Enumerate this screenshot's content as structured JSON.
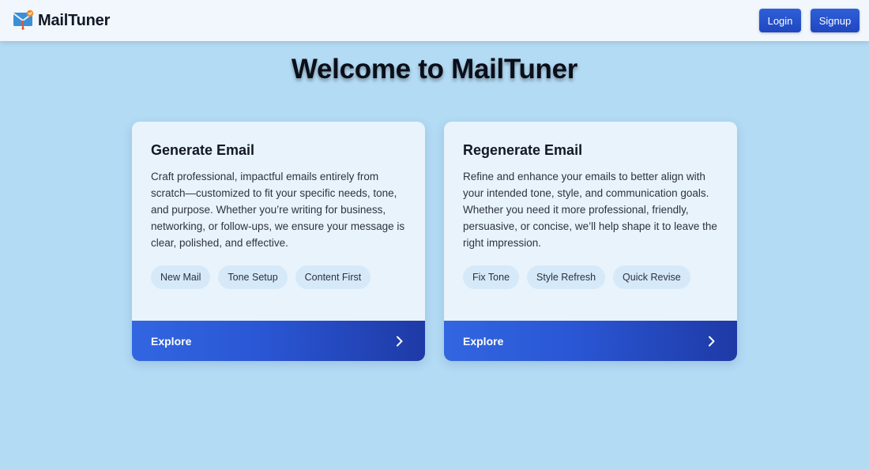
{
  "header": {
    "brand": "MailTuner",
    "login_label": "Login",
    "signup_label": "Signup"
  },
  "main": {
    "title": "Welcome to MailTuner",
    "cards": [
      {
        "title": "Generate Email",
        "description": "Craft professional, impactful emails entirely from scratch—customized to fit your specific needs, tone, and purpose. Whether you’re writing for business, networking, or follow-ups, we ensure your message is clear, polished, and effective.",
        "tags": [
          "New Mail",
          "Tone Setup",
          "Content First"
        ],
        "action_label": "Explore",
        "action_icon": "chevron-right-icon"
      },
      {
        "title": "Regenerate Email",
        "description": "Refine and enhance your emails to better align with your intended tone, style, and communication goals. Whether you need it more professional, friendly, persuasive, or concise, we’ll help shape it to leave the right impression.",
        "tags": [
          "Fix Tone",
          "Style Refresh",
          "Quick Revise"
        ],
        "action_label": "Explore",
        "action_icon": "chevron-right-icon"
      }
    ]
  },
  "colors": {
    "page_background": "#b3dbf4",
    "navbar_background": "#f1f7fd",
    "button_primary": "#2451cc",
    "card_background": "#e8f3fc",
    "chip_background": "#d6e9f8",
    "footer_gradient_start": "#3266e0",
    "footer_gradient_end": "#1e3aa6"
  },
  "icons": {
    "logo": "mail-logo-icon"
  }
}
